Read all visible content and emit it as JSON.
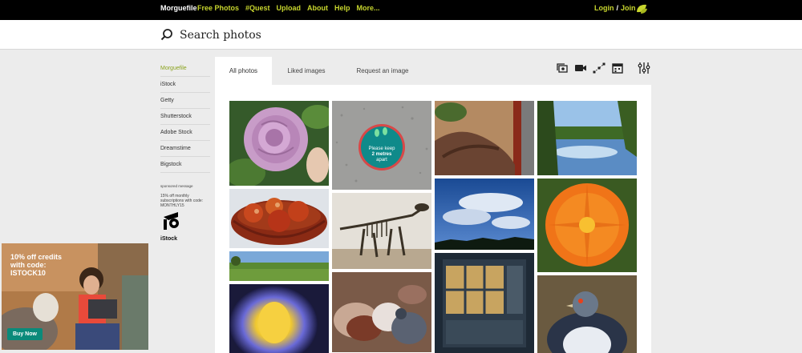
{
  "nav": {
    "brand": "Morguefile",
    "links": [
      "Free Photos",
      "#Quest",
      "Upload",
      "About",
      "Help",
      "More..."
    ],
    "login": "Login",
    "separator": "/",
    "join": "Join"
  },
  "search": {
    "placeholder": "Search photos"
  },
  "sidebar": {
    "items": [
      {
        "label": "Morguefile",
        "active": true
      },
      {
        "label": "iStock",
        "active": false
      },
      {
        "label": "Getty",
        "active": false
      },
      {
        "label": "Shutterstock",
        "active": false
      },
      {
        "label": "Adobe Stock",
        "active": false
      },
      {
        "label": "Dreamstime",
        "active": false
      },
      {
        "label": "Bigstock",
        "active": false
      }
    ],
    "sponsored_label": "sponsored message",
    "promo_text": "15% off monthly subscriptions with code: MONTHLY15",
    "promo_brand": "iStock"
  },
  "tabs": {
    "items": [
      {
        "label": "All photos",
        "active": true
      },
      {
        "label": "Liked images",
        "active": false
      },
      {
        "label": "Request an image",
        "active": false
      }
    ]
  },
  "tools": {
    "icons": [
      "photo-stack-icon",
      "video-camera-icon",
      "vector-icon",
      "calendar-icon",
      "filter-sliders-icon"
    ]
  },
  "gallery": {
    "photos": [
      {
        "name": "pink-rose",
        "color": "#c99ac7"
      },
      {
        "name": "keep-2-metres-sign",
        "color": "#9c9c9a",
        "sign_line1": "Please keep",
        "sign_line2": "2 metres",
        "sign_line3": "apart"
      },
      {
        "name": "carved-driftwood",
        "color": "#8a6a52"
      },
      {
        "name": "lake-reflection",
        "color": "#5a8bbf"
      },
      {
        "name": "apples-basket",
        "color": "#b43a1e"
      },
      {
        "name": "dinosaur-skeleton",
        "color": "#5e5447"
      },
      {
        "name": "cloudy-sky",
        "color": "#2a5b9c"
      },
      {
        "name": "orange-poppy",
        "color": "#ef6a12"
      },
      {
        "name": "green-field",
        "color": "#6a8d3a"
      },
      {
        "name": "pigeons",
        "color": "#8d6a56"
      },
      {
        "name": "building-window",
        "color": "#3a4858"
      },
      {
        "name": "glowing-orb",
        "color": "#6a5ad0"
      },
      {
        "name": "pigeon-portrait",
        "color": "#3b4a6a"
      }
    ]
  },
  "ad": {
    "headline": "10% off credits with code: ISTOCK10",
    "button": "Buy Now"
  }
}
